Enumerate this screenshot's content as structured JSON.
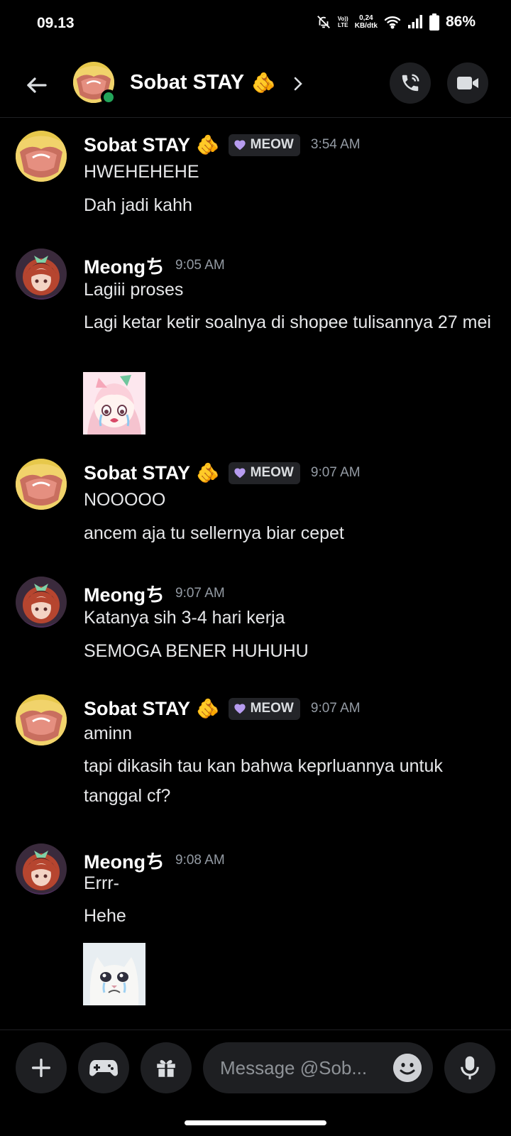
{
  "status_bar": {
    "time": "09.13",
    "net_top": "Vo))",
    "net_bottom": "LTE",
    "speed_value": "0,24",
    "speed_unit": "KB/dtk",
    "battery": "86%"
  },
  "header": {
    "title": "Sobat STAY",
    "title_emoji": "🫵",
    "online": true
  },
  "messages": [
    {
      "author": "Sobat STAY",
      "author_emoji": "🫵",
      "tag": "MEOW",
      "tag_icon": "purple-heart",
      "time": "3:54 AM",
      "lines": [
        "HWEHEHEHE",
        "Dah jadi kahh"
      ]
    },
    {
      "author": "Meongち",
      "time": "9:05 AM",
      "lines": [
        "Lagiii proses",
        "Lagi ketar ketir soalnya di shopee tulisannya 27 mei"
      ],
      "sticker": "anime-girl-crying-sticker"
    },
    {
      "author": "Sobat STAY",
      "author_emoji": "🫵",
      "tag": "MEOW",
      "tag_icon": "purple-heart",
      "time": "9:07 AM",
      "lines": [
        "NOOOOO",
        "ancem aja tu sellernya biar cepet"
      ]
    },
    {
      "author": "Meongち",
      "time": "9:07 AM",
      "lines": [
        "Katanya sih 3-4 hari kerja",
        "SEMOGA BENER HUHUHU"
      ]
    },
    {
      "author": "Sobat STAY",
      "author_emoji": "🫵",
      "tag": "MEOW",
      "tag_icon": "purple-heart",
      "time": "9:07 AM",
      "lines": [
        "aminn",
        "tapi dikasih tau kan bahwa keprluannya untuk tanggal cf?"
      ]
    },
    {
      "author": "Meongち",
      "time": "9:08 AM",
      "lines": [
        "Errr-",
        "Hehe"
      ],
      "sticker": "crying-cat-sticker"
    }
  ],
  "composer": {
    "placeholder": "Message @Sob..."
  },
  "colors": {
    "background": "#000000",
    "surface": "#1e1f22",
    "online": "#23a55a",
    "timestamp": "#949ba4",
    "tag_heart": "#b79cf0"
  }
}
